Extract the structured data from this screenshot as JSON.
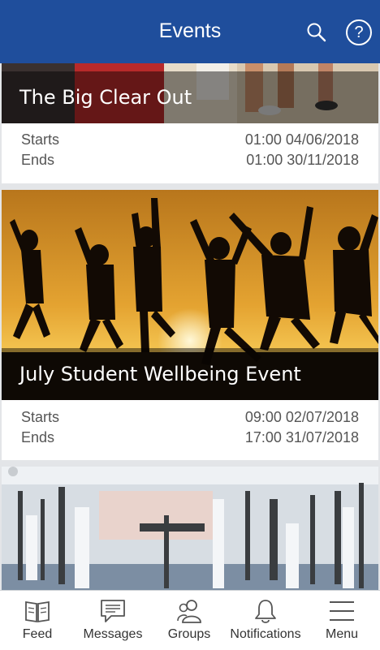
{
  "header": {
    "title": "Events",
    "search_icon": "search-icon",
    "help_icon": "help-icon",
    "help_glyph": "?"
  },
  "colors": {
    "header": "#1f4e9c",
    "tabbar": "#ffffff",
    "background": "#e3e5e8"
  },
  "events": [
    {
      "title": "The Big Clear Out",
      "starts_label": "Starts",
      "starts_value": "01:00 04/06/2018",
      "ends_label": "Ends",
      "ends_value": "01:00 30/11/2018"
    },
    {
      "title": "July Student Wellbeing Event",
      "starts_label": "Starts",
      "starts_value": "09:00 02/07/2018",
      "ends_label": "Ends",
      "ends_value": "17:00 31/07/2018"
    }
  ],
  "tabs": [
    {
      "label": "Feed",
      "icon": "book-icon"
    },
    {
      "label": "Messages",
      "icon": "chat-icon"
    },
    {
      "label": "Groups",
      "icon": "people-icon"
    },
    {
      "label": "Notifications",
      "icon": "bell-icon"
    },
    {
      "label": "Menu",
      "icon": "hamburger-icon"
    }
  ]
}
